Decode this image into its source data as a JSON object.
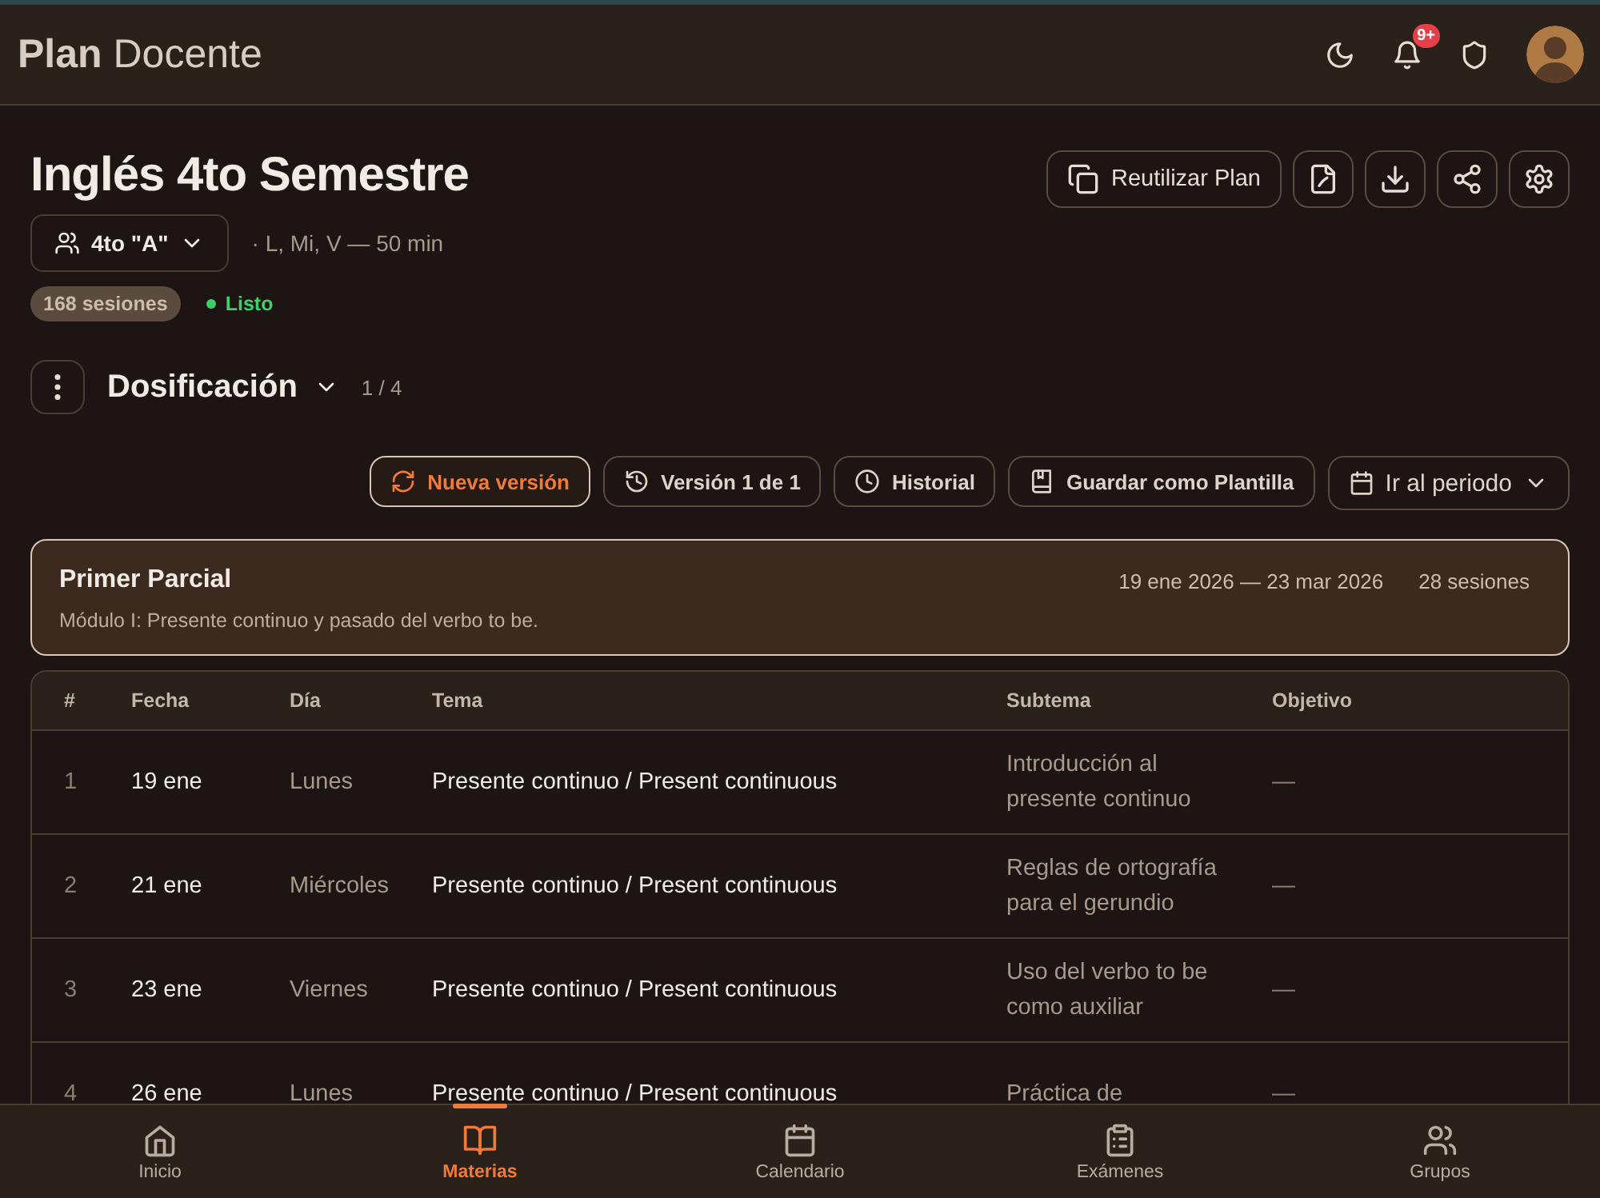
{
  "app": {
    "title_bold": "Plan",
    "title_rest": "Docente",
    "notifications": "9+"
  },
  "plan": {
    "title": "Inglés 4to Semestre",
    "group": "4to \"A\"",
    "schedule": "· L, Mi, V — 50 min",
    "sessions": "168 sesiones",
    "status": "Listo"
  },
  "actions": [
    {
      "label": "Reutilizar Plan"
    }
  ],
  "section": {
    "title": "Dosificación",
    "page": "1 / 4"
  },
  "toolbar": [
    {
      "label": "Nueva versión",
      "kind": "primary"
    },
    {
      "label": "Versión 1 de 1",
      "kind": "default"
    },
    {
      "label": "Historial",
      "kind": "default"
    },
    {
      "label": "Guardar como Plantilla",
      "kind": "default"
    },
    {
      "label": "Ir al periodo",
      "kind": "dropdown"
    }
  ],
  "period": {
    "title": "Primer Parcial",
    "dates": "19 ene 2026 — 23 mar 2026",
    "sessions": "28 sesiones",
    "description": "Módulo I: Presente continuo y pasado del verbo to be."
  },
  "table": {
    "columns": [
      "#",
      "Fecha",
      "Día",
      "Tema",
      "Subtema",
      "Objetivo"
    ],
    "rows": [
      [
        "1",
        "19 ene",
        "Lunes",
        "Presente continuo / Present continuous",
        "Introducción al presente continuo",
        "—"
      ],
      [
        "2",
        "21 ene",
        "Miércoles",
        "Presente continuo / Present continuous",
        "Reglas de ortografía para el gerundio",
        "—"
      ],
      [
        "3",
        "23 ene",
        "Viernes",
        "Presente continuo / Present continuous",
        "Uso del verbo to be como auxiliar",
        "—"
      ],
      [
        "4",
        "26 ene",
        "Lunes",
        "Presente continuo / Present continuous",
        "Práctica de",
        "—"
      ]
    ]
  },
  "nav": [
    {
      "label": "Inicio",
      "selected": false
    },
    {
      "label": "Materias",
      "selected": true
    },
    {
      "label": "Calendario",
      "selected": false
    },
    {
      "label": "Exámenes",
      "selected": false
    },
    {
      "label": "Grupos",
      "selected": false
    }
  ]
}
